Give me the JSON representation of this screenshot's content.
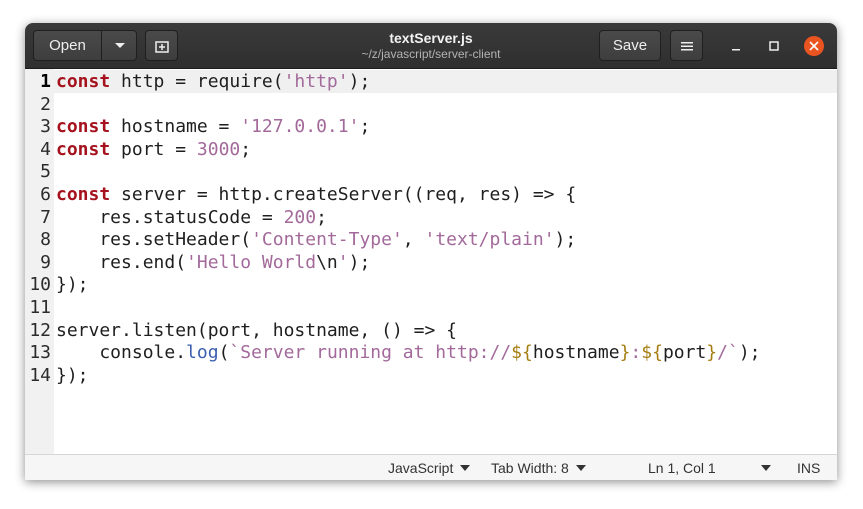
{
  "titlebar": {
    "open_label": "Open",
    "save_label": "Save",
    "title": "textServer.js",
    "subtitle": "~/z/javascript/server-client"
  },
  "editor": {
    "lines": [
      {
        "n": "1",
        "tokens": [
          [
            "kw",
            "const"
          ],
          [
            "plain",
            " http = require("
          ],
          [
            "str",
            "'http'"
          ],
          [
            "plain",
            ");"
          ]
        ]
      },
      {
        "n": "2",
        "tokens": []
      },
      {
        "n": "3",
        "tokens": [
          [
            "kw",
            "const"
          ],
          [
            "plain",
            " hostname = "
          ],
          [
            "str",
            "'127.0.0.1'"
          ],
          [
            "plain",
            ";"
          ]
        ]
      },
      {
        "n": "4",
        "tokens": [
          [
            "kw",
            "const"
          ],
          [
            "plain",
            " port = "
          ],
          [
            "num",
            "3000"
          ],
          [
            "plain",
            ";"
          ]
        ]
      },
      {
        "n": "5",
        "tokens": []
      },
      {
        "n": "6",
        "tokens": [
          [
            "kw",
            "const"
          ],
          [
            "plain",
            " server = http.createServer((req, res) => {"
          ]
        ]
      },
      {
        "n": "7",
        "tokens": [
          [
            "plain",
            "    res.statusCode = "
          ],
          [
            "num",
            "200"
          ],
          [
            "plain",
            ";"
          ]
        ]
      },
      {
        "n": "8",
        "tokens": [
          [
            "plain",
            "    res.setHeader("
          ],
          [
            "str",
            "'Content-Type'"
          ],
          [
            "plain",
            ", "
          ],
          [
            "str",
            "'text/plain'"
          ],
          [
            "plain",
            ");"
          ]
        ]
      },
      {
        "n": "9",
        "tokens": [
          [
            "plain",
            "    res.end("
          ],
          [
            "str",
            "'Hello World"
          ],
          [
            "plain",
            "\\n"
          ],
          [
            "str",
            "'"
          ],
          [
            "plain",
            ");"
          ]
        ]
      },
      {
        "n": "10",
        "tokens": [
          [
            "plain",
            "});"
          ]
        ]
      },
      {
        "n": "11",
        "tokens": []
      },
      {
        "n": "12",
        "tokens": [
          [
            "plain",
            "server.listen(port, hostname, () => {"
          ]
        ]
      },
      {
        "n": "13",
        "tokens": [
          [
            "plain",
            "    console."
          ],
          [
            "fn",
            "log"
          ],
          [
            "plain",
            "("
          ],
          [
            "str",
            "`Server running at http://"
          ],
          [
            "tpl",
            "${"
          ],
          [
            "plain",
            "hostname"
          ],
          [
            "tpl",
            "}"
          ],
          [
            "str",
            ":"
          ],
          [
            "tpl",
            "${"
          ],
          [
            "plain",
            "port"
          ],
          [
            "tpl",
            "}"
          ],
          [
            "str",
            "/`"
          ],
          [
            "plain",
            ");"
          ]
        ]
      },
      {
        "n": "14",
        "tokens": [
          [
            "plain",
            "});"
          ]
        ]
      }
    ]
  },
  "statusbar": {
    "language": "JavaScript",
    "tab_width": "Tab Width: 8",
    "position": "Ln 1, Col 1",
    "mode": "INS"
  },
  "colors": {
    "keyword": "#a5121d",
    "string": "#a2699a",
    "function": "#3b5fae",
    "template": "#a67d12",
    "close_button": "#e95420"
  },
  "icons": [
    "dropdown-arrow-icon",
    "new-tab-icon",
    "hamburger-menu-icon",
    "minimize-icon",
    "maximize-icon",
    "close-icon"
  ]
}
